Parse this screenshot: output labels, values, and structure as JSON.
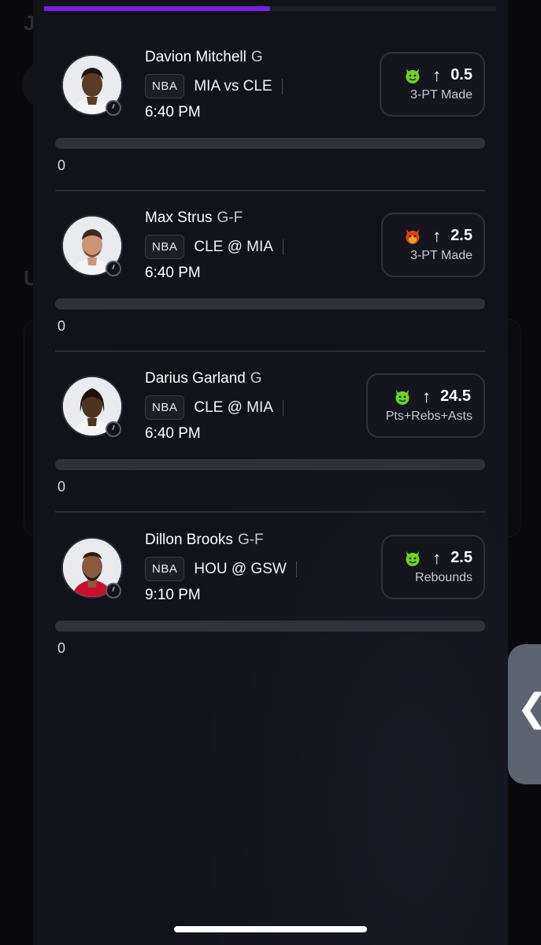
{
  "progress": {
    "fraction": 0.5
  },
  "background_hints": [
    "Jo",
    "U"
  ],
  "picks": [
    {
      "name": "Davion Mitchell",
      "position": "G",
      "league": "NBA",
      "matchup": "MIA vs CLE",
      "time": "6:40 PM",
      "emoji": "green-devil-icon",
      "direction": "↑",
      "line": "0.5",
      "stat": "3-PT Made",
      "progress_value": "0",
      "progress_fraction": 0
    },
    {
      "name": "Max Strus",
      "position": "G-F",
      "league": "NBA",
      "matchup": "CLE @ MIA",
      "time": "6:40 PM",
      "emoji": "red-devil-icon",
      "direction": "↑",
      "line": "2.5",
      "stat": "3-PT Made",
      "progress_value": "0",
      "progress_fraction": 0
    },
    {
      "name": "Darius Garland",
      "position": "G",
      "league": "NBA",
      "matchup": "CLE @ MIA",
      "time": "6:40 PM",
      "emoji": "green-devil-icon",
      "direction": "↑",
      "line": "24.5",
      "stat": "Pts+Rebs+Asts",
      "progress_value": "0",
      "progress_fraction": 0
    },
    {
      "name": "Dillon Brooks",
      "position": "G-F",
      "league": "NBA",
      "matchup": "HOU @ GSW",
      "time": "9:10 PM",
      "emoji": "green-devil-icon",
      "direction": "↑",
      "line": "2.5",
      "stat": "Rebounds",
      "progress_value": "0",
      "progress_fraction": 0
    }
  ],
  "side_tab": {
    "glyph": "❮"
  },
  "colors": {
    "accent": "#7a1ee6",
    "green_emoji": "#6fd12b",
    "red_emoji": "#d9431c"
  }
}
